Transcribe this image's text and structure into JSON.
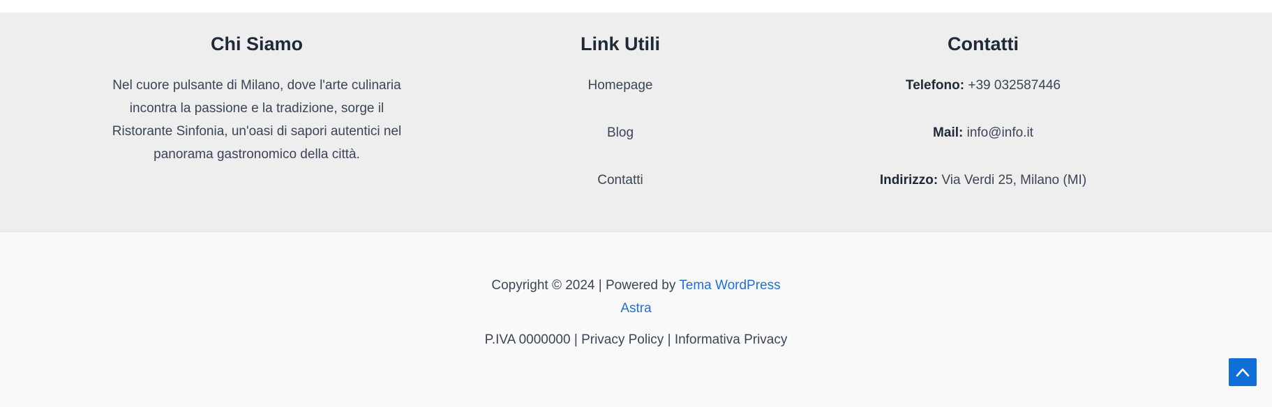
{
  "about": {
    "title": "Chi Siamo",
    "text": "Nel cuore pulsante di Milano, dove l'arte culinaria incontra la passione e la tradizione, sorge il Ristorante Sinfonia, un'oasi di sapori autentici nel panorama gastronomico della città."
  },
  "links": {
    "title": "Link Utili",
    "items": [
      {
        "label": "Homepage"
      },
      {
        "label": "Blog"
      },
      {
        "label": "Contatti"
      }
    ]
  },
  "contacts": {
    "title": "Contatti",
    "phone_label": "Telefono:",
    "phone_value": " +39 032587446",
    "mail_label": "Mail:",
    "mail_value": " info@info.it",
    "address_label": "Indirizzo:",
    "address_value": " Via Verdi 25, Milano (MI)"
  },
  "copyright": {
    "prefix": "Copyright © 2024 | Powered by ",
    "link": "Tema WordPress Astra",
    "piva": "P.IVA 0000000",
    "sep1": " | ",
    "privacy_policy": "Privacy Policy",
    "sep2": " | ",
    "informativa": "Informativa Privacy"
  },
  "scroll_top": {
    "icon": "chevron-up-icon"
  },
  "colors": {
    "link": "#1e6fd9",
    "scroll_button": "#0f6fd6",
    "widgets_bg": "#eeeeee",
    "bottom_bg": "#f9f9f9"
  }
}
